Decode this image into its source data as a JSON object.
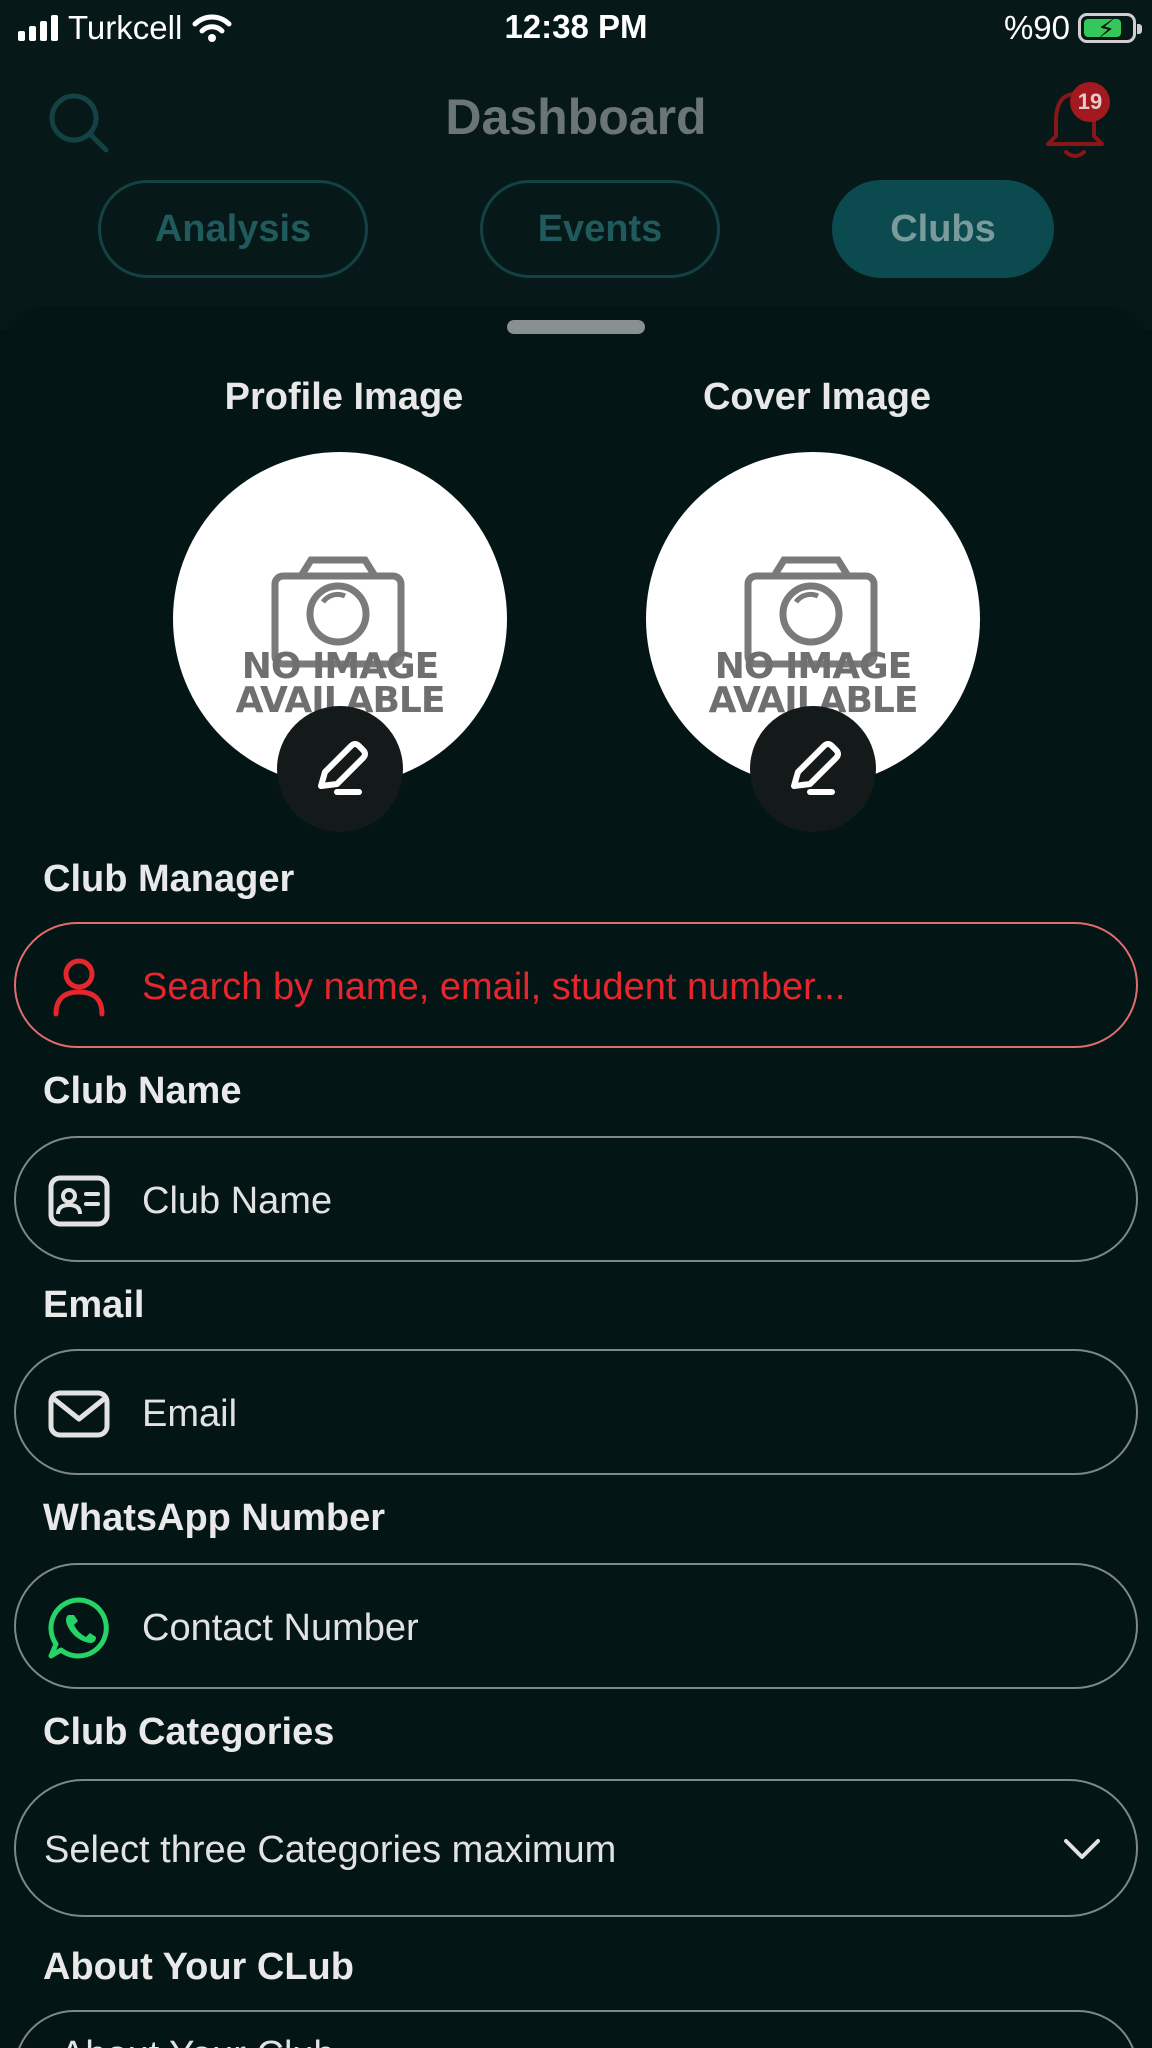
{
  "status_bar": {
    "carrier": "Turkcell",
    "time": "12:38 PM",
    "battery": "%90"
  },
  "header": {
    "title": "Dashboard",
    "notification_count": "19",
    "icons": [
      "search-icon",
      "bell-icon"
    ]
  },
  "tabs": [
    {
      "label": "Analysis",
      "active": false
    },
    {
      "label": "Events",
      "active": false
    },
    {
      "label": "Clubs",
      "active": true
    }
  ],
  "images": {
    "profile_label": "Profile Image",
    "cover_label": "Cover Image",
    "placeholder_line1": "NO IMAGE",
    "placeholder_line2": "AVAILABLE"
  },
  "form": {
    "manager_label": "Club Manager",
    "manager_placeholder": "Search by name, email, student number...",
    "name_label": "Club Name",
    "name_placeholder": "Club Name",
    "email_label": "Email",
    "email_placeholder": "Email",
    "whatsapp_label": "WhatsApp Number",
    "whatsapp_placeholder": "Contact Number",
    "categories_label": "Club Categories",
    "categories_placeholder": "Select three Categories maximum",
    "about_label": "About Your CLub",
    "about_placeholder": "About Your Club"
  },
  "colors": {
    "background": "#041516",
    "accent": "#0b4a4f",
    "error": "#e6262d",
    "whatsapp": "#25d366",
    "badge": "#a21a1f"
  }
}
